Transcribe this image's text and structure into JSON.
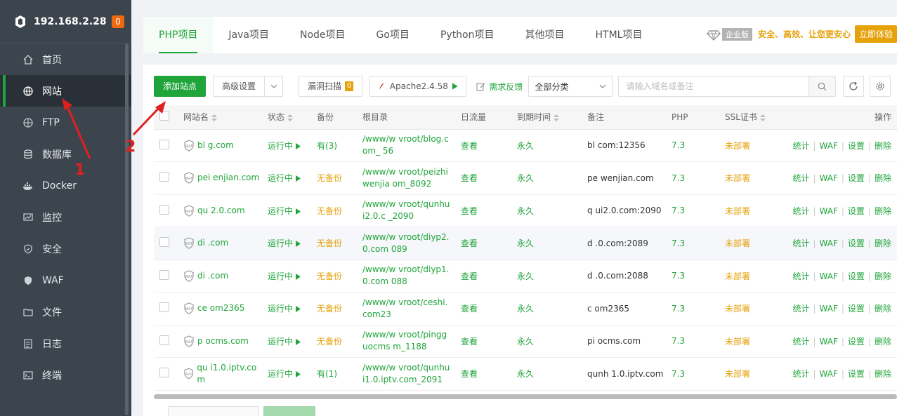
{
  "sidebar": {
    "server_ip": "192.168.2.28",
    "badge_count": "0",
    "items": [
      {
        "label": "首页",
        "icon": "home-icon"
      },
      {
        "label": "网站",
        "icon": "globe-icon"
      },
      {
        "label": "FTP",
        "icon": "ftp-icon"
      },
      {
        "label": "数据库",
        "icon": "database-icon"
      },
      {
        "label": "Docker",
        "icon": "docker-icon"
      },
      {
        "label": "监控",
        "icon": "monitor-icon"
      },
      {
        "label": "安全",
        "icon": "shield-icon"
      },
      {
        "label": "WAF",
        "icon": "waf-icon"
      },
      {
        "label": "文件",
        "icon": "folder-icon"
      },
      {
        "label": "日志",
        "icon": "log-icon"
      },
      {
        "label": "终端",
        "icon": "terminal-icon"
      }
    ]
  },
  "tabs": [
    "PHP项目",
    "Java项目",
    "Node项目",
    "Go项目",
    "Python项目",
    "其他项目",
    "HTML项目"
  ],
  "enterprise": {
    "tag": "企业版",
    "slogan": "安全、高效、让您更安心",
    "try_button": "立即体验"
  },
  "toolbar": {
    "add_site": "添加站点",
    "advanced": "高级设置",
    "vuln_scan": "漏洞扫描",
    "vuln_count": "0",
    "apache": "Apache2.4.58",
    "feedback": "需求反馈",
    "category": "全部分类",
    "search_placeholder": "请输入域名或备注"
  },
  "table": {
    "headers": {
      "name": "网站名",
      "status": "状态",
      "backup": "备份",
      "root": "根目录",
      "traffic": "日流量",
      "expire": "到期时间",
      "remark": "备注",
      "php": "PHP",
      "ssl": "SSL证书",
      "ops": "操作"
    },
    "rows": [
      {
        "name": "bl    g.com",
        "status": "运行中",
        "backup": "有(3)",
        "backup_ok": true,
        "root": "/www/w     vroot/blog.com_     56",
        "traffic": "查看",
        "expire": "永久",
        "remark": "bl      com:12356",
        "php": "7.3",
        "ssl": "未部署"
      },
      {
        "name": "pei     enjian.com",
        "status": "运行中",
        "backup": "无备份",
        "backup_ok": false,
        "root": "/www/w     vroot/peizhiwenjia    om_8092",
        "traffic": "查看",
        "expire": "永久",
        "remark": "pe      wenjian.com",
        "php": "7.3",
        "ssl": "未部署"
      },
      {
        "name": "qu     2.0.com",
        "status": "运行中",
        "backup": "无备份",
        "backup_ok": false,
        "root": "/www/w     vroot/qunhui2.0.c    _2090",
        "traffic": "查看",
        "expire": "永久",
        "remark": "q      ui2.0.com:2090",
        "php": "7.3",
        "ssl": "未部署"
      },
      {
        "name": "di     .com",
        "status": "运行中",
        "backup": "无备份",
        "backup_ok": false,
        "root": "/www/w     vroot/diyp2.0.com     089",
        "traffic": "查看",
        "expire": "永久",
        "remark": "d      .0.com:2089",
        "php": "7.3",
        "ssl": "未部署"
      },
      {
        "name": "di     .com",
        "status": "运行中",
        "backup": "无备份",
        "backup_ok": false,
        "root": "/www/w     vroot/diyp1.0.com     088",
        "traffic": "查看",
        "expire": "永久",
        "remark": "d      .0.com:2088",
        "php": "7.3",
        "ssl": "未部署"
      },
      {
        "name": "ce     om2365",
        "status": "运行中",
        "backup": "无备份",
        "backup_ok": false,
        "root": "/www/w     vroot/ceshi.com23",
        "traffic": "查看",
        "expire": "永久",
        "remark": "c      om2365",
        "php": "7.3",
        "ssl": "未部署"
      },
      {
        "name": "p     ocms.com",
        "status": "运行中",
        "backup": "无备份",
        "backup_ok": false,
        "root": "/www/w     vroot/pingguocms     m_1188",
        "traffic": "查看",
        "expire": "永久",
        "remark": "pi      ocms.com",
        "php": "7.3",
        "ssl": "未部署"
      },
      {
        "name": "qu     i1.0.iptv.com",
        "status": "运行中",
        "backup": "有(1)",
        "backup_ok": true,
        "root": "/www/w     vroot/qunhui1.0.iptv.com_2091",
        "traffic": "查看",
        "expire": "永久",
        "remark": "qunh      1.0.iptv.com",
        "php": "7.3",
        "ssl": "未部署"
      }
    ],
    "ops": [
      "统计",
      "WAF",
      "设置",
      "删除"
    ]
  },
  "annotations": {
    "one": "1",
    "two": "2"
  },
  "colors": {
    "accent": "#20a53a",
    "warning": "#e6a20b",
    "sidebar": "#3c444d",
    "annotation": "#e02020"
  }
}
